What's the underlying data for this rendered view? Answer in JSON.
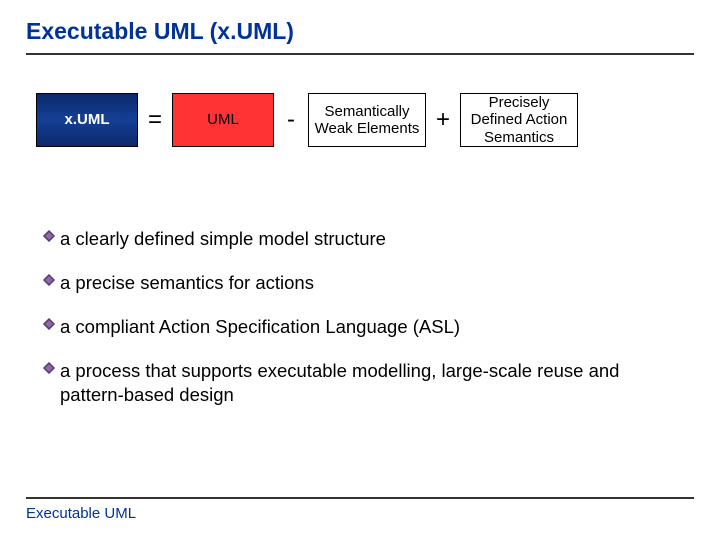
{
  "title": "Executable UML (x.UML)",
  "equation": {
    "lhs": "x.UML",
    "op1": "=",
    "term1": "UML",
    "op2": "-",
    "term2": "Semantically Weak Elements",
    "op3": "+",
    "term3": "Precisely Defined Action Semantics"
  },
  "bullets": [
    "a clearly defined simple model structure",
    "a precise semantics for actions",
    "a compliant Action Specification Language (ASL)",
    "a process that supports executable modelling, large-scale reuse and pattern-based design"
  ],
  "footer": "Executable UML"
}
